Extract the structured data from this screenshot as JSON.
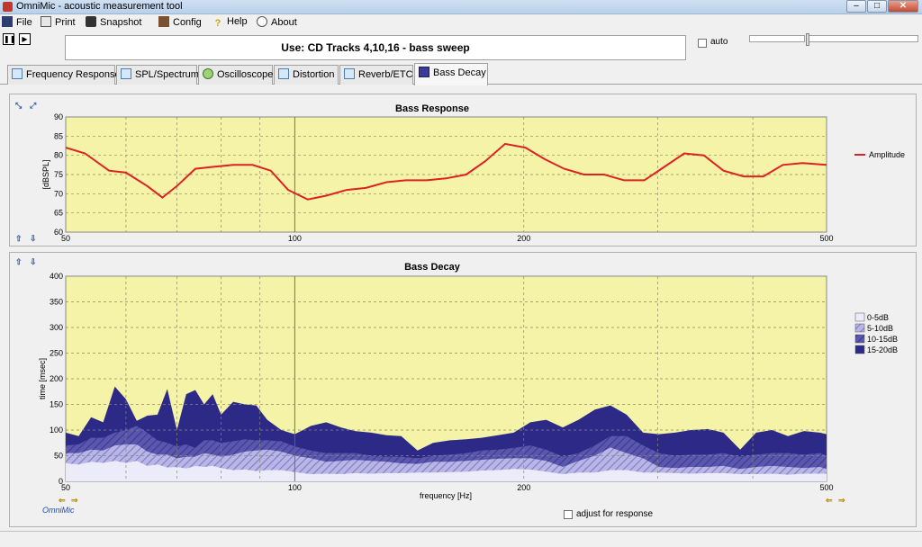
{
  "window": {
    "title": "OmniMic - acoustic measurement tool"
  },
  "menu": [
    {
      "id": "file",
      "label": "File"
    },
    {
      "id": "print",
      "label": "Print"
    },
    {
      "id": "snapshot",
      "label": "Snapshot"
    },
    {
      "id": "config",
      "label": "Config"
    },
    {
      "id": "help",
      "label": "Help"
    },
    {
      "id": "about",
      "label": "About"
    }
  ],
  "toolbar": {
    "instruction": "Use: CD Tracks 4,10,16 - bass sweep",
    "auto_label": "auto",
    "auto_checked": false
  },
  "tabs": [
    {
      "label": "Frequency Response",
      "icon": "frequency-response-icon"
    },
    {
      "label": "SPL/Spectrum",
      "icon": "spl-spectrum-icon"
    },
    {
      "label": "Oscilloscope",
      "icon": "oscilloscope-icon"
    },
    {
      "label": "Distortion",
      "icon": "distortion-icon"
    },
    {
      "label": "Reverb/ETC",
      "icon": "reverb-etc-icon"
    },
    {
      "label": "Bass Decay",
      "icon": "bass-decay-icon",
      "active": true
    }
  ],
  "footer": {
    "brand": "OmniMic",
    "adjust_label": "adjust for response",
    "adjust_checked": false
  },
  "colors": {
    "plot_background": "#f5f3a8",
    "amplitude_line": "#dd2222",
    "band_0_5": "#ecebf9",
    "band_5_10": "#9d9ad6",
    "band_10_15": "#4e4ba3",
    "band_15_20": "#2c2a86"
  },
  "chart_data": [
    {
      "type": "line",
      "title": "Bass Response",
      "xlabel": "",
      "ylabel": "[dBSPL]",
      "xscale": "log",
      "xlim": [
        50,
        500
      ],
      "ylim": [
        60,
        90
      ],
      "x_ticks": [
        "50",
        "100",
        "200",
        "500"
      ],
      "y_ticks": [
        "60",
        "65",
        "70",
        "75",
        "80",
        "85",
        "90"
      ],
      "grid": true,
      "legend_position": "right",
      "series": [
        {
          "name": "Amplitude",
          "x": [
            50,
            53,
            57,
            60,
            64,
            67,
            70,
            74,
            78,
            83,
            88,
            93,
            98,
            104,
            110,
            117,
            124,
            132,
            140,
            149,
            158,
            168,
            178,
            189,
            201,
            213,
            226,
            240,
            255,
            271,
            288,
            306,
            325,
            345,
            366,
            389,
            413,
            438,
            465,
            500
          ],
          "y": [
            82,
            80.5,
            76,
            75.5,
            72,
            69,
            72,
            76.5,
            77,
            77.5,
            77.5,
            76,
            71,
            68.5,
            69.5,
            71,
            71.5,
            73,
            73.5,
            73.5,
            74,
            75,
            78.5,
            83,
            82,
            79,
            76.5,
            75,
            75,
            73.5,
            73.5,
            77,
            80.5,
            80,
            76,
            74.5,
            74.5,
            77.5,
            78,
            77.5
          ]
        }
      ]
    },
    {
      "type": "area",
      "title": "Bass Decay",
      "xlabel": "frequency [Hz]",
      "ylabel": "time [msec]",
      "xscale": "log",
      "xlim": [
        50,
        500
      ],
      "ylim": [
        0,
        400
      ],
      "x_ticks": [
        "50",
        "100",
        "200",
        "500"
      ],
      "y_ticks": [
        "0",
        "50",
        "100",
        "150",
        "200",
        "250",
        "300",
        "350",
        "400"
      ],
      "grid": true,
      "legend_position": "right",
      "x": [
        50,
        52,
        54,
        56,
        58,
        60,
        62,
        64,
        66,
        68,
        70,
        72,
        74,
        76,
        78,
        80,
        83,
        86,
        89,
        92,
        96,
        100,
        105,
        110,
        115,
        120,
        126,
        132,
        138,
        145,
        152,
        160,
        168,
        176,
        185,
        194,
        204,
        214,
        225,
        236,
        248,
        260,
        273,
        287,
        301,
        316,
        332,
        349,
        366,
        385,
        404,
        424,
        445,
        467,
        490,
        500
      ],
      "series": [
        {
          "name": "0-5dB",
          "values": [
            35,
            33,
            38,
            36,
            40,
            36,
            40,
            30,
            33,
            27,
            28,
            25,
            30,
            28,
            30,
            26,
            22,
            23,
            20,
            22,
            22,
            18,
            14,
            15,
            14,
            16,
            15,
            16,
            16,
            17,
            17,
            18,
            19,
            21,
            22,
            24,
            23,
            19,
            14,
            17,
            17,
            22,
            22,
            17,
            17,
            16,
            15,
            16,
            16,
            14,
            14,
            15,
            13,
            15,
            15,
            15
          ]
        },
        {
          "name": "5-10dB",
          "values": [
            55,
            55,
            62,
            60,
            70,
            72,
            72,
            58,
            52,
            52,
            45,
            48,
            48,
            55,
            52,
            48,
            52,
            58,
            60,
            62,
            58,
            50,
            45,
            38,
            40,
            42,
            40,
            38,
            35,
            34,
            38,
            38,
            40,
            42,
            44,
            45,
            45,
            40,
            28,
            40,
            50,
            66,
            55,
            45,
            28,
            26,
            28,
            28,
            30,
            24,
            28,
            30,
            28,
            26,
            28,
            24
          ]
        },
        {
          "name": "10-15dB",
          "values": [
            70,
            72,
            85,
            85,
            95,
            100,
            108,
            95,
            80,
            75,
            68,
            72,
            65,
            80,
            80,
            75,
            78,
            82,
            80,
            80,
            78,
            68,
            60,
            55,
            55,
            55,
            50,
            48,
            48,
            45,
            50,
            52,
            55,
            60,
            62,
            65,
            70,
            62,
            48,
            55,
            70,
            88,
            88,
            70,
            55,
            50,
            52,
            52,
            55,
            48,
            52,
            55,
            55,
            52,
            55,
            50
          ]
        },
        {
          "name": "15-20dB",
          "values": [
            95,
            88,
            125,
            115,
            185,
            160,
            118,
            128,
            130,
            180,
            100,
            170,
            178,
            150,
            170,
            130,
            155,
            150,
            148,
            120,
            100,
            92,
            108,
            115,
            105,
            98,
            95,
            90,
            88,
            60,
            75,
            80,
            82,
            85,
            90,
            95,
            115,
            120,
            105,
            120,
            140,
            148,
            130,
            95,
            92,
            95,
            100,
            102,
            95,
            62,
            95,
            100,
            88,
            98,
            95,
            92
          ]
        }
      ]
    }
  ]
}
